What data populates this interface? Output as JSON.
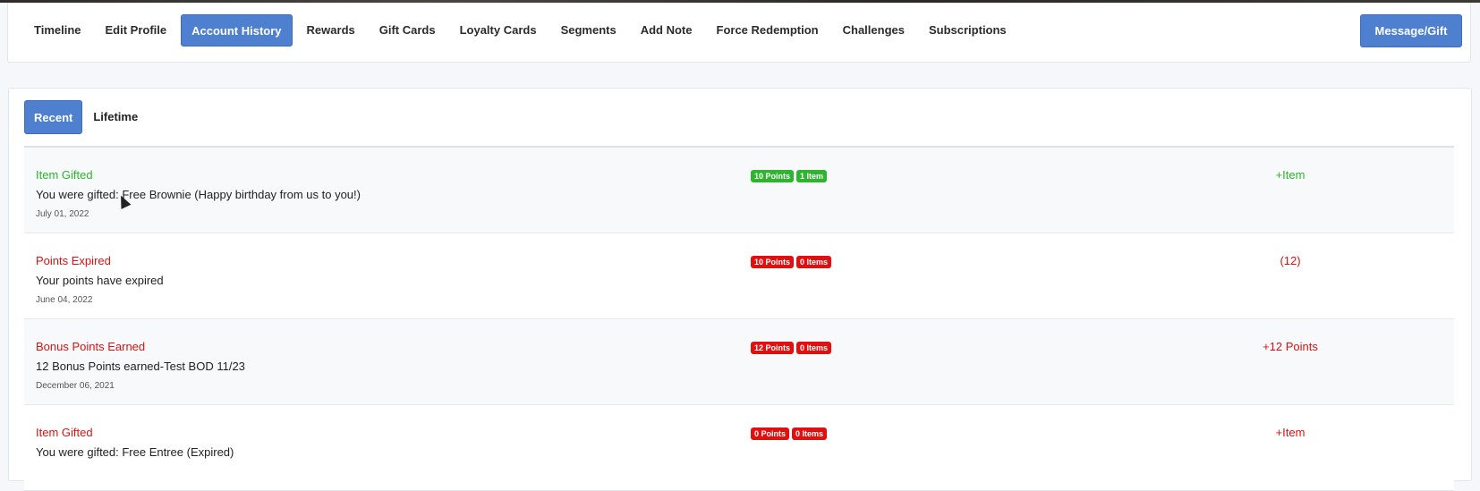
{
  "nav": {
    "tabs": [
      {
        "label": "Timeline"
      },
      {
        "label": "Edit Profile"
      },
      {
        "label": "Account History",
        "active": true
      },
      {
        "label": "Rewards"
      },
      {
        "label": "Gift Cards"
      },
      {
        "label": "Loyalty Cards"
      },
      {
        "label": "Segments"
      },
      {
        "label": "Add Note"
      },
      {
        "label": "Force Redemption"
      },
      {
        "label": "Challenges"
      },
      {
        "label": "Subscriptions"
      }
    ],
    "message_button": "Message/Gift"
  },
  "history": {
    "tabs": [
      {
        "label": "Recent",
        "active": true
      },
      {
        "label": "Lifetime"
      }
    ],
    "rows": [
      {
        "title": "Item Gifted",
        "title_color": "#2db52d",
        "description": "You were gifted: Free Brownie (Happy birthday from us to you!)",
        "date": "July 01, 2022",
        "badges": [
          {
            "text": "10 Points",
            "color": "#2eb52e"
          },
          {
            "text": "1 Item",
            "color": "#2eb52e"
          }
        ],
        "amount": "+Item",
        "amount_color": "#2db52d"
      },
      {
        "title": "Points Expired",
        "title_color": "#dd1111",
        "description": "Your points have expired",
        "date": "June 04, 2022",
        "badges": [
          {
            "text": "10 Points",
            "color": "#e01010"
          },
          {
            "text": "0 Items",
            "color": "#e01010"
          }
        ],
        "amount": "(12)",
        "amount_color": "#dd1111"
      },
      {
        "title": "Bonus Points Earned",
        "title_color": "#dd1111",
        "description": "12 Bonus Points earned-Test BOD 11/23",
        "date": "December 06, 2021",
        "badges": [
          {
            "text": "12 Points",
            "color": "#e01010"
          },
          {
            "text": "0 Items",
            "color": "#e01010"
          }
        ],
        "amount": "+12 Points",
        "amount_color": "#dd1111"
      },
      {
        "title": "Item Gifted",
        "title_color": "#dd1111",
        "description": "You were gifted: Free Entree (Expired)",
        "date": "",
        "badges": [
          {
            "text": "0 Points",
            "color": "#e01010"
          },
          {
            "text": "0 Items",
            "color": "#e01010"
          }
        ],
        "amount": "+Item",
        "amount_color": "#dd1111"
      }
    ]
  },
  "colors": {
    "accent": "#4f7fcf",
    "success": "#2db52d",
    "danger": "#dd1111"
  }
}
